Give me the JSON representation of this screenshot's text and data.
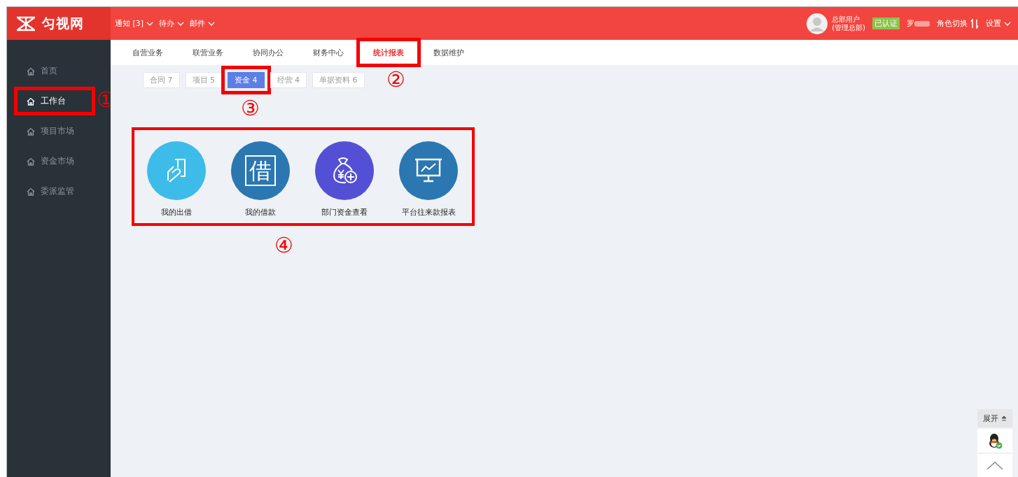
{
  "header": {
    "logo": "匀视网",
    "menus": [
      {
        "label": "通知 [3]"
      },
      {
        "label": "待办"
      },
      {
        "label": "邮件"
      }
    ],
    "user": {
      "line1": "总部用户",
      "line2": "(管理总部)",
      "badge": "已认证",
      "username": "罗",
      "role_switch": "角色切换",
      "settings": "设置"
    }
  },
  "sidebar": {
    "items": [
      {
        "label": "首页",
        "selected": false
      },
      {
        "label": "工作台",
        "selected": true,
        "annotation": "①"
      },
      {
        "label": "项目市场",
        "selected": false
      },
      {
        "label": "资金市场",
        "selected": false
      },
      {
        "label": "委派监管",
        "selected": false
      }
    ]
  },
  "tabs": [
    {
      "label": "自营业务",
      "selected": false
    },
    {
      "label": "联营业务",
      "selected": false
    },
    {
      "label": "协同办公",
      "selected": false
    },
    {
      "label": "财务中心",
      "selected": false
    },
    {
      "label": "统计报表",
      "selected": true,
      "annotation": "②"
    },
    {
      "label": "数据维护",
      "selected": false
    }
  ],
  "subtabs": [
    {
      "label": "合同 7",
      "selected": false
    },
    {
      "label": "项目 5",
      "selected": false
    },
    {
      "label": "资金 4",
      "selected": true,
      "annotation": "③"
    },
    {
      "label": "经营 4",
      "selected": false
    },
    {
      "label": "单据资料 6",
      "selected": false
    }
  ],
  "apps": {
    "annotation": "④",
    "items": [
      {
        "label": "我的出借",
        "color": "#3dbce9",
        "kind": "card-hand"
      },
      {
        "label": "我的借款",
        "color": "#2b77b1",
        "kind": "glyph",
        "glyph": "借"
      },
      {
        "label": "部门资金查看",
        "color": "#5350d5",
        "kind": "money-bag"
      },
      {
        "label": "平台往来款报表",
        "color": "#2b77b1",
        "kind": "chart-board"
      }
    ]
  },
  "float_panel": {
    "expand": "展开"
  }
}
